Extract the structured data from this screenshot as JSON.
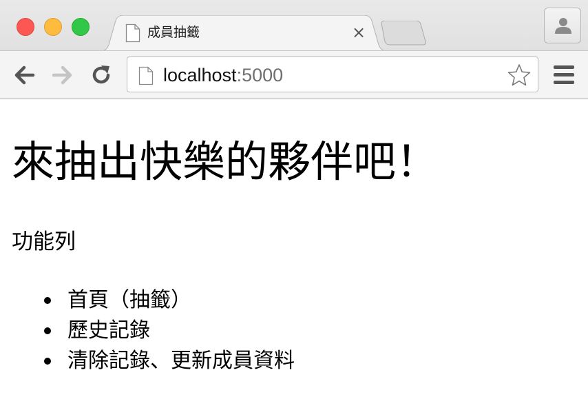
{
  "browser": {
    "tab": {
      "title": "成員抽籤",
      "close_glyph": "×"
    },
    "address_bar": {
      "host": "localhost",
      "port": ":5000"
    },
    "icons": {
      "back": "back-arrow-icon",
      "forward": "forward-arrow-icon",
      "reload": "reload-icon",
      "bookmark": "star-icon",
      "menu": "hamburger-menu-icon",
      "profile": "person-icon",
      "page": "page-icon"
    },
    "colors": {
      "close": "#fc5753",
      "minimize": "#fdbc40",
      "maximize": "#33c748"
    }
  },
  "page": {
    "heading": "來抽出快樂的夥伴吧！",
    "nav_title": "功能列",
    "nav_items": [
      {
        "label": "首頁（抽籤）"
      },
      {
        "label": "歷史記錄"
      },
      {
        "label": "清除記錄、更新成員資料"
      }
    ]
  }
}
